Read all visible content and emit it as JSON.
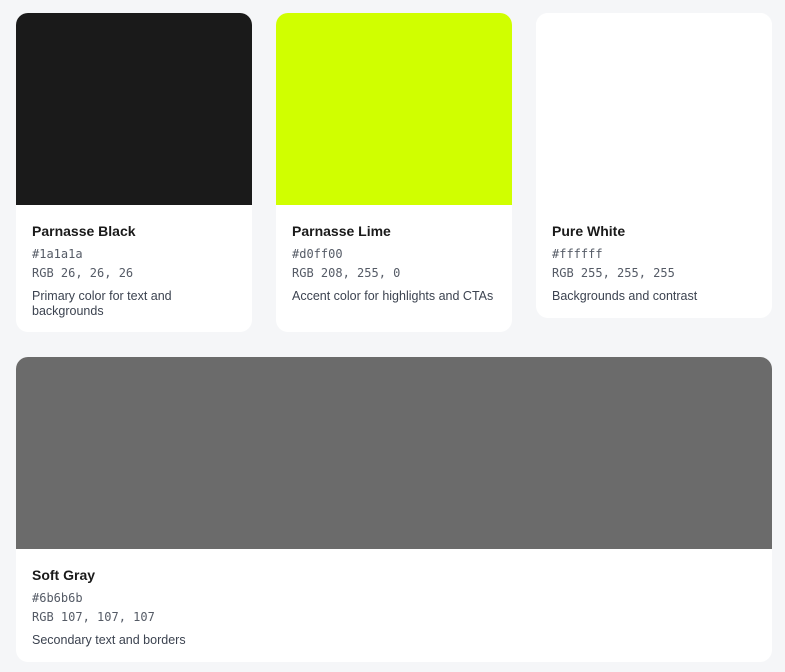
{
  "swatches": [
    {
      "name": "Parnasse Black",
      "hex": "#1a1a1a",
      "rgb": "RGB 26, 26, 26",
      "description": "Primary color for text and backgrounds",
      "color": "#1a1a1a"
    },
    {
      "name": "Parnasse Lime",
      "hex": "#d0ff00",
      "rgb": "RGB 208, 255, 0",
      "description": "Accent color for highlights and CTAs",
      "color": "#d0ff00"
    },
    {
      "name": "Pure White",
      "hex": "#ffffff",
      "rgb": "RGB 255, 255, 255",
      "description": "Backgrounds and contrast",
      "color": "#ffffff"
    },
    {
      "name": "Soft Gray",
      "hex": "#6b6b6b",
      "rgb": "RGB 107, 107, 107",
      "description": "Secondary text and borders",
      "color": "#6b6b6b"
    }
  ]
}
